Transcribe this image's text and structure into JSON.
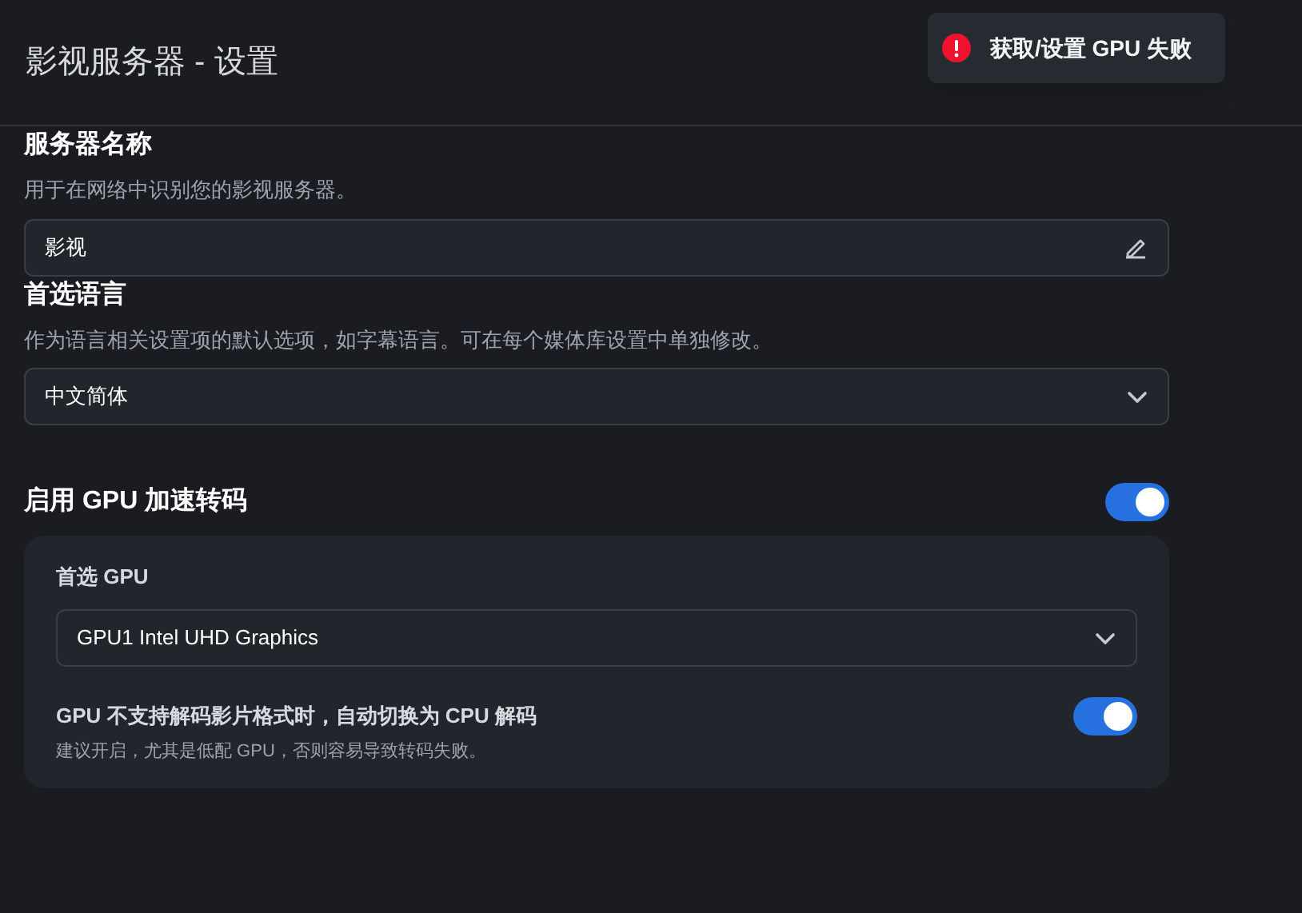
{
  "header": {
    "title": "影视服务器 - 设置"
  },
  "toast": {
    "kind": "error",
    "message": "获取/设置 GPU 失败"
  },
  "server_name": {
    "label": "服务器名称",
    "description": "用于在网络中识别您的影视服务器。",
    "value": "影视"
  },
  "language": {
    "label": "首选语言",
    "description": "作为语言相关设置项的默认选项，如字幕语言。可在每个媒体库设置中单独修改。",
    "value": "中文简体"
  },
  "gpu": {
    "label": "启用 GPU 加速转码",
    "on": true,
    "preferred": {
      "label": "首选 GPU",
      "value": "GPU1 Intel UHD Graphics"
    },
    "fallback": {
      "label": "GPU 不支持解码影片格式时，自动切换为 CPU 解码",
      "description": "建议开启，尤其是低配 GPU，否则容易导致转码失败。",
      "on": true
    }
  }
}
